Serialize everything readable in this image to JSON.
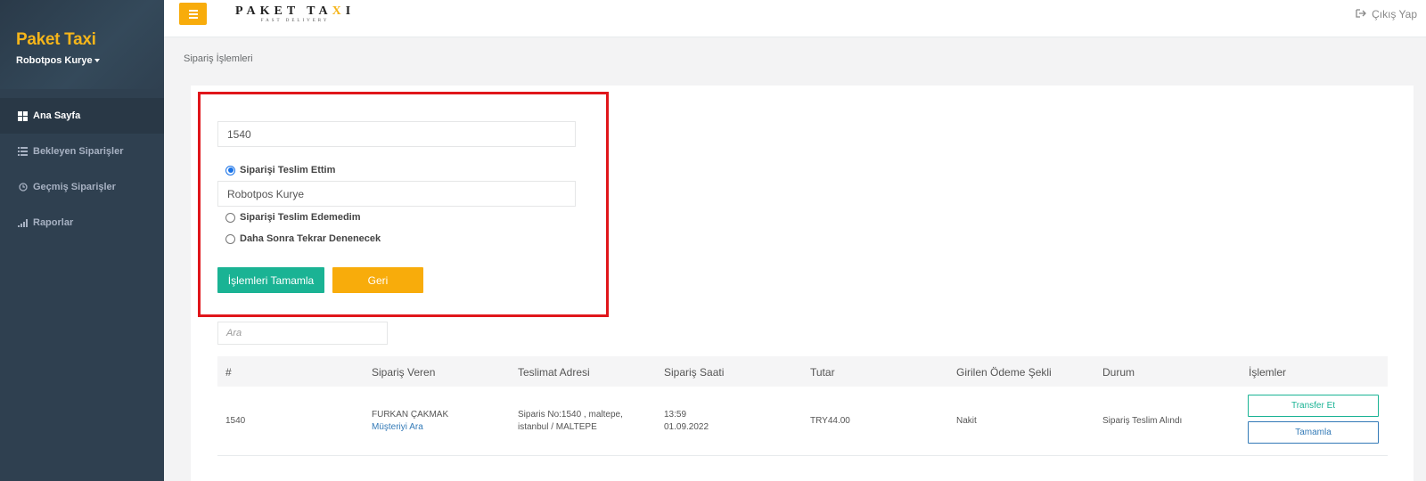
{
  "sidebar": {
    "brand": "Paket Taxi",
    "user": "Robotpos Kurye",
    "items": [
      {
        "label": "Ana Sayfa"
      },
      {
        "label": "Bekleyen Siparişler"
      },
      {
        "label": "Geçmiş Siparişler"
      },
      {
        "label": "Raporlar"
      }
    ]
  },
  "topbar": {
    "logo_main_a": "PAKET TA",
    "logo_main_x": "X",
    "logo_main_b": "I",
    "logo_sub": "FAST DELIVERY",
    "logout": "Çıkış Yap"
  },
  "breadcrumb": "Sipariş İşlemleri",
  "form": {
    "order_no": "1540",
    "options": [
      {
        "label": "Siparişi Teslim Ettim",
        "checked": true
      },
      {
        "label": "Siparişi Teslim Edemedim",
        "checked": false
      },
      {
        "label": "Daha Sonra Tekrar Denenecek",
        "checked": false
      }
    ],
    "courier": "Robotpos Kurye",
    "complete_button": "İşlemleri Tamamla",
    "back_button": "Geri"
  },
  "search": {
    "placeholder": "Ara"
  },
  "table": {
    "headers": [
      "#",
      "Sipariş Veren",
      "Teslimat Adresi",
      "Sipariş Saati",
      "Tutar",
      "Girilen Ödeme Şekli",
      "Durum",
      "İşlemler"
    ],
    "rows": [
      {
        "id": "1540",
        "customer": "FURKAN ÇAKMAK",
        "call_link": "Müşteriyi Ara",
        "address_line1": "Siparis No:1540 , maltepe,",
        "address_line2": "istanbul / MALTEPE",
        "time": "13:59",
        "date": "01.09.2022",
        "amount": "TRY44.00",
        "payment": "Nakit",
        "status": "Sipariş Teslim Alındı",
        "transfer_button": "Transfer Et",
        "complete_button": "Tamamla"
      }
    ]
  },
  "colors": {
    "accent": "#f8ac0b",
    "primary": "#1ab394",
    "sidebar": "#2f4050",
    "highlight": "#e0161b"
  }
}
